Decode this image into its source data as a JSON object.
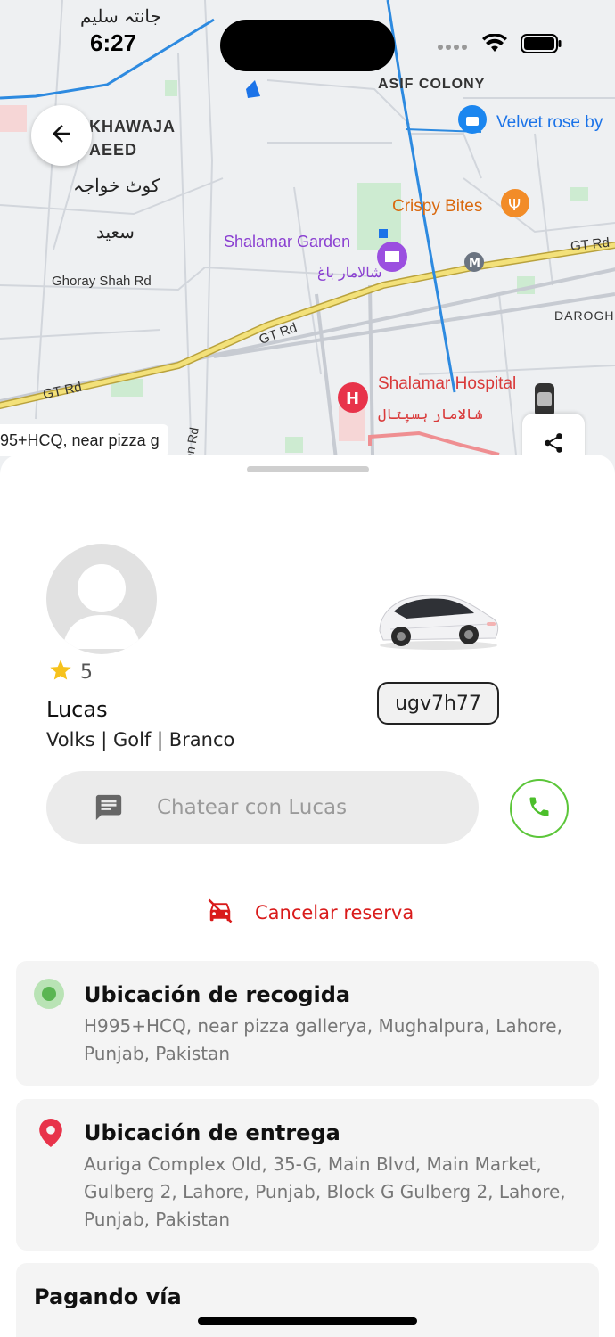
{
  "status_bar": {
    "time": "6:27",
    "icons": [
      "cellular-dots-icon",
      "wifi-icon",
      "battery-icon"
    ]
  },
  "map": {
    "labels": {
      "khawaja_1": "KHAWAJA",
      "khawaja_2": "AEED",
      "asif_colony": "ASIF COLONY",
      "velvet_rose": "Velvet rose by",
      "crispy_bites": "Crispy Bites",
      "shalamar_garden": "Shalamar Garden",
      "shalamar_garden_urdu": "شالامار باغ",
      "ghoray_shah": "Ghoray Shah Rd",
      "gt_rd_1": "GT Rd",
      "gt_rd_2": "GT Rd",
      "gt_rd_3": "GT Rd",
      "darogh": "DAROGH",
      "shalamar_hospital": "Shalamar Hospital",
      "shalamar_hospital_urdu": "شالامار ہسپتال",
      "kot_khawaja": "کوٹ خواجہ",
      "saeed": "سعید",
      "top_urdu": "جانتہ سلیم",
      "rd": "en Rd",
      "metro": "M"
    },
    "address_chip": "95+HCQ, near pizza g"
  },
  "buttons": {
    "back_icon": "arrow-left-icon",
    "share_icon": "share-icon"
  },
  "driver": {
    "rating": "5",
    "name": "Lucas",
    "vehicle": "Volks | Golf | Branco",
    "plate": "ugv7h77"
  },
  "chat": {
    "placeholder": "Chatear con Lucas"
  },
  "cancel": {
    "label": "Cancelar reserva"
  },
  "pickup": {
    "title": "Ubicación de recogida",
    "address": "H995+HCQ, near pizza gallerya, Mughalpura, Lahore, Punjab, Pakistan"
  },
  "dropoff": {
    "title": "Ubicación de entrega",
    "address": "Auriga Complex Old, 35-G, Main Blvd, Main Market, Gulberg 2, Lahore, Punjab, Block G Gulberg 2, Lahore, Punjab, Pakistan"
  },
  "payment": {
    "title": "Pagando vía"
  },
  "colors": {
    "accent_green": "#5cc63a",
    "cancel_red": "#d91b1b",
    "pin_red": "#e8334a",
    "road_yellow": "#f3e17a"
  }
}
